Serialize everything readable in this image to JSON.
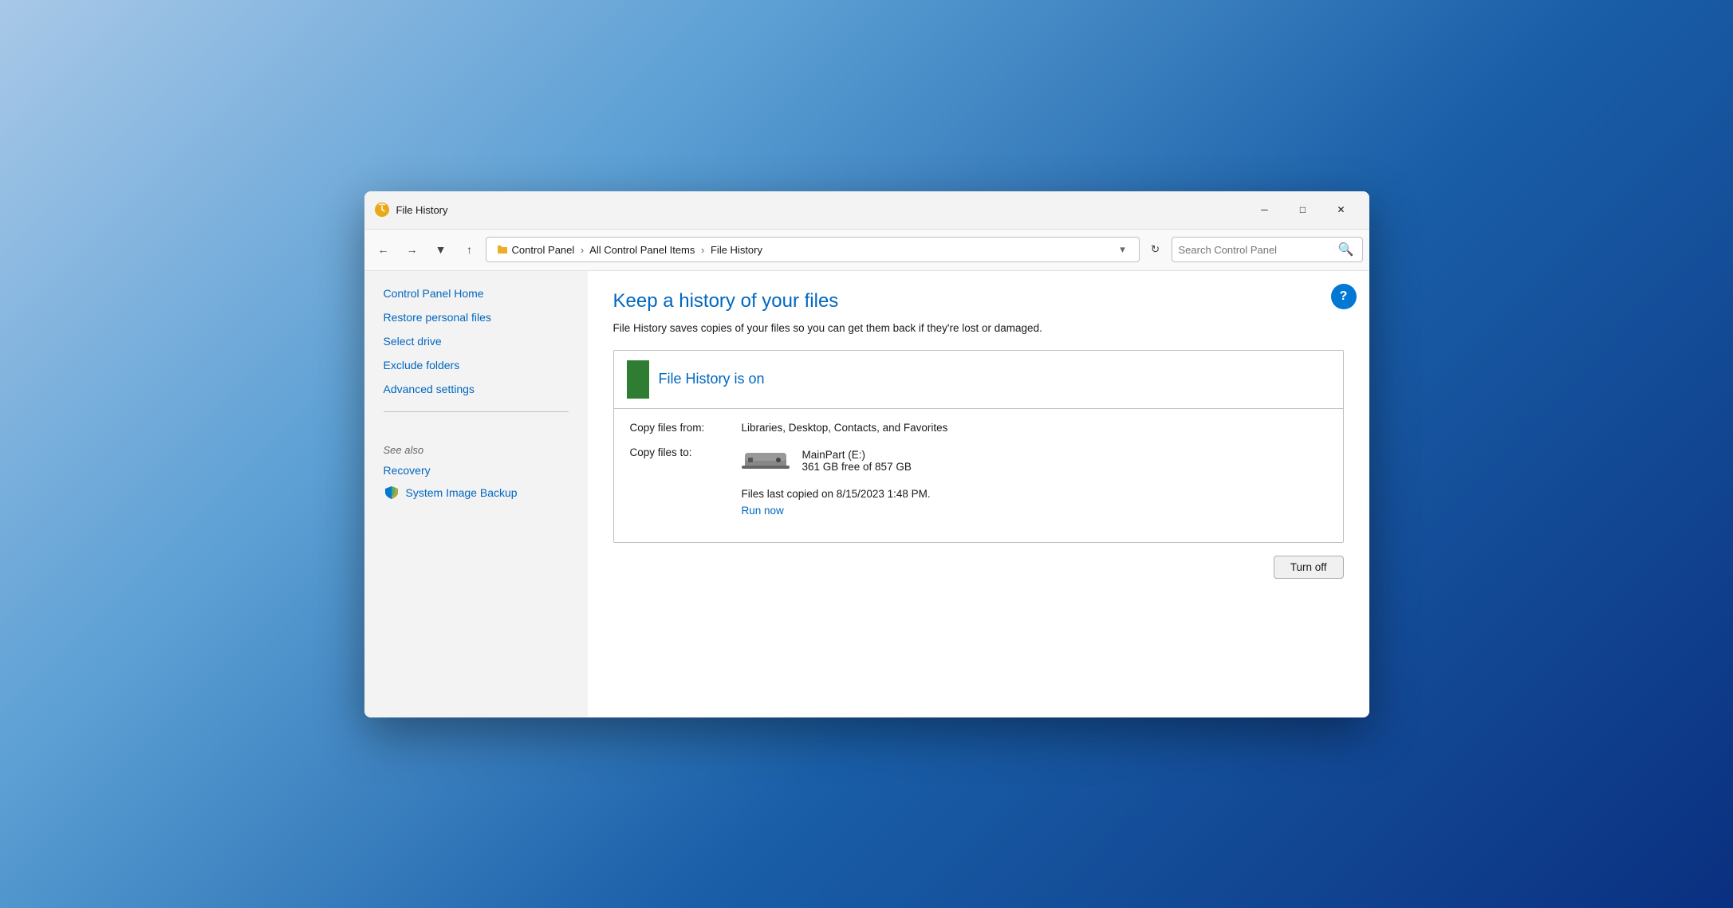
{
  "window": {
    "title": "File History",
    "icon_label": "file-history-icon"
  },
  "titlebar": {
    "minimize_label": "─",
    "maximize_label": "□",
    "close_label": "✕"
  },
  "addressbar": {
    "back_title": "Back",
    "forward_title": "Forward",
    "dropdown_title": "Recent locations",
    "up_title": "Up to All Control Panel Items",
    "breadcrumb": "Control Panel  ›  All Control Panel Items  ›  File History",
    "breadcrumb_parts": [
      "Control Panel",
      "All Control Panel Items",
      "File History"
    ],
    "chevron_label": "▾",
    "refresh_title": "Refresh",
    "search_placeholder": "Search Control Panel"
  },
  "sidebar": {
    "links": [
      {
        "label": "Control Panel Home",
        "name": "control-panel-home-link"
      },
      {
        "label": "Restore personal files",
        "name": "restore-personal-files-link"
      },
      {
        "label": "Select drive",
        "name": "select-drive-link"
      },
      {
        "label": "Exclude folders",
        "name": "exclude-folders-link"
      },
      {
        "label": "Advanced settings",
        "name": "advanced-settings-link"
      }
    ],
    "see_also_heading": "See also",
    "see_also_links": [
      {
        "label": "Recovery",
        "name": "recovery-link",
        "has_icon": false
      },
      {
        "label": "System Image Backup",
        "name": "system-image-backup-link",
        "has_icon": true
      }
    ]
  },
  "content": {
    "heading": "Keep a history of your files",
    "subtitle": "File History saves copies of your files so you can get them back if they're lost or damaged.",
    "status_title": "File History is on",
    "copy_files_from_label": "Copy files from:",
    "copy_files_from_value": "Libraries, Desktop, Contacts, and Favorites",
    "copy_files_to_label": "Copy files to:",
    "drive_name": "MainPart (E:)",
    "drive_size": "361 GB free of 857 GB",
    "last_copied_text": "Files last copied on 8/15/2023 1:48 PM.",
    "run_now_label": "Run now",
    "turn_off_label": "Turn off",
    "help_label": "?"
  }
}
